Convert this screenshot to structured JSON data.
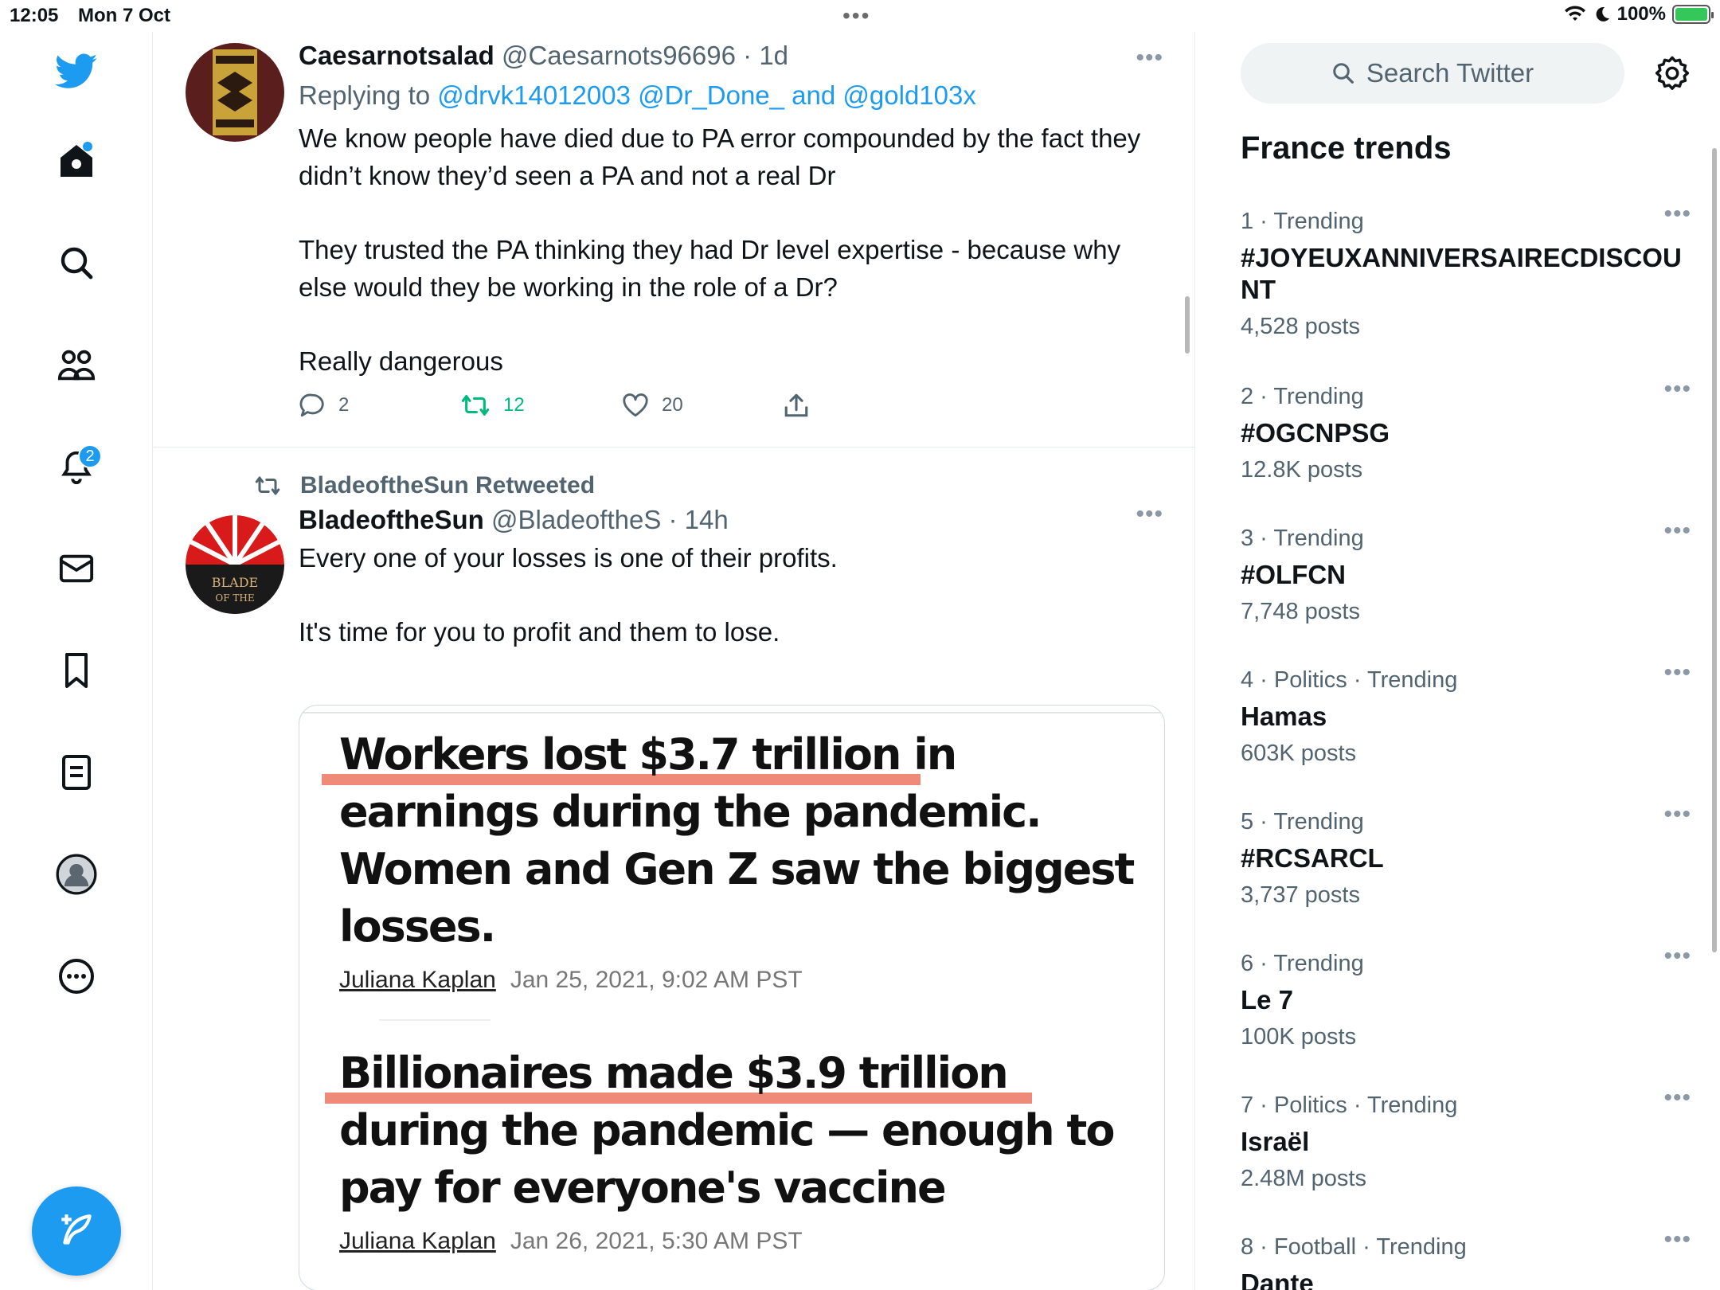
{
  "status_bar": {
    "time": "12:05",
    "date": "Mon 7 Oct",
    "battery": "100%"
  },
  "nav": {
    "items": [
      "home",
      "explore",
      "communities",
      "notifications",
      "messages",
      "bookmarks",
      "lists",
      "profile",
      "more"
    ],
    "notification_count": "2"
  },
  "tweets": [
    {
      "display_name": "Caesarnotsalad",
      "handle": "@Caesarnots96696",
      "time": "· 1d",
      "replying_prefix": "Replying to ",
      "replying_users": "@drvk14012003 @Dr_Done_ and @gold103x",
      "paragraphs": [
        "We know people have died due to PA error compounded by the fact they didn’t know they’d seen a PA and not a real Dr",
        "They trusted the PA thinking they had Dr level expertise - because why else would they be working in the role of a Dr?",
        "Really dangerous"
      ],
      "replies": "2",
      "retweets": "12",
      "likes": "20"
    },
    {
      "retweeted_by": "BladeoftheSun Retweeted",
      "display_name": "BladeoftheSun",
      "handle": "@BladeoftheS",
      "time": "· 14h",
      "paragraphs": [
        "Every one of your losses is one of their profits.",
        "It's time for you to profit and them to lose."
      ],
      "media": {
        "headline1": "Workers lost $3.7 trillion in earnings during the pandemic. Women and Gen Z saw the biggest losses.",
        "author1": "Juliana Kaplan",
        "date1": "Jan 25, 2021, 9:02 AM PST",
        "headline2": "Billionaires made $3.9 trillion during the pandemic — enough to pay for everyone's vaccine",
        "author2": "Juliana Kaplan",
        "date2": "Jan 26, 2021, 5:30 AM PST"
      }
    }
  ],
  "sidebar": {
    "search_placeholder": "Search Twitter",
    "trends_title": "France trends",
    "trends": [
      {
        "meta": "1 · Trending",
        "name": "#JOYEUXANNIVERSAIRECDISCOUNT",
        "count": "4,528 posts"
      },
      {
        "meta": "2 · Trending",
        "name": "#OGCNPSG",
        "count": "12.8K posts"
      },
      {
        "meta": "3 · Trending",
        "name": "#OLFCN",
        "count": "7,748 posts"
      },
      {
        "meta": "4 · Politics · Trending",
        "name": "Hamas",
        "count": "603K posts"
      },
      {
        "meta": "5 · Trending",
        "name": "#RCSARCL",
        "count": "3,737 posts"
      },
      {
        "meta": "6 · Trending",
        "name": "Le 7",
        "count": "100K posts"
      },
      {
        "meta": "7 · Politics · Trending",
        "name": "Israël",
        "count": "2.48M posts"
      },
      {
        "meta": "8 · Football · Trending",
        "name": "Dante",
        "count": ""
      }
    ]
  },
  "colors": {
    "accent": "#1d9bf0",
    "retweet_green": "#00ba7c",
    "highlight_underline": "#f08a78"
  }
}
